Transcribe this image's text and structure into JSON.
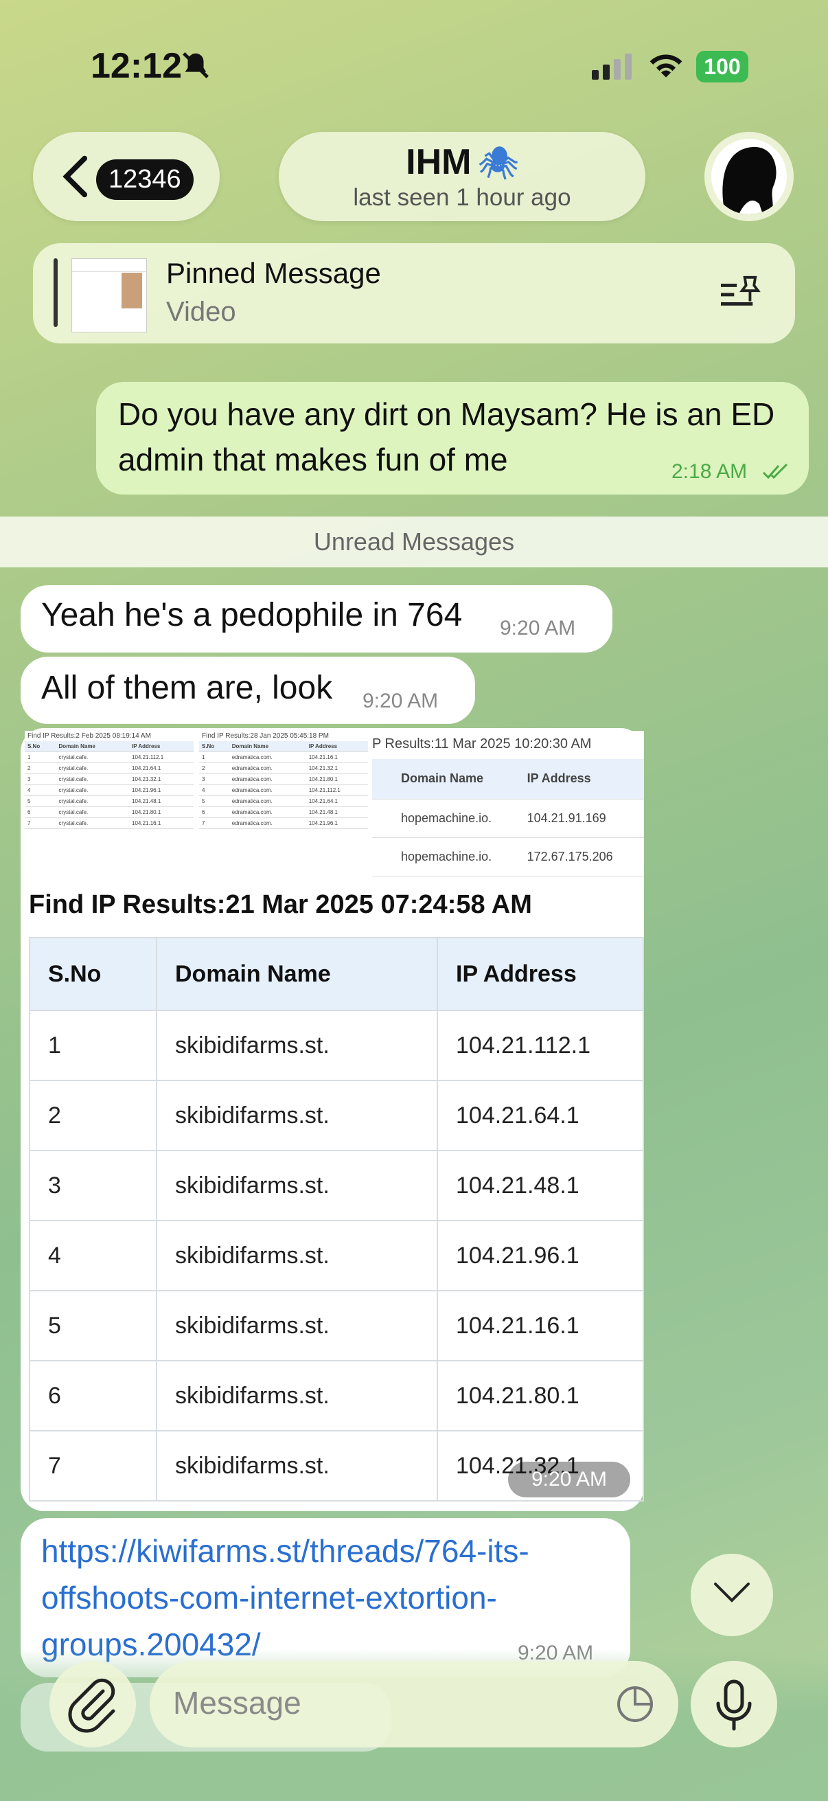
{
  "status_bar": {
    "time": "12:12",
    "battery": "100"
  },
  "header": {
    "back_count": "12346",
    "title": "IHM",
    "title_emoji": "🕷",
    "subtitle": "last seen 1 hour ago"
  },
  "pinned": {
    "title": "Pinned Message",
    "subtitle": "Video"
  },
  "messages": {
    "out_1": {
      "text": "Do you have any dirt on Maysam? He is an ED admin that makes fun of me",
      "time": "2:18 AM"
    },
    "unread_label": "Unread Messages",
    "in_1": {
      "text": "Yeah he's a pedophile in 764",
      "time": "9:20 AM"
    },
    "in_2": {
      "text": "All of them are, look",
      "time": "9:20 AM"
    },
    "album_time": "9:20 AM",
    "link": {
      "text": "https://kiwifarms.st/threads/764-its-offshoots-com-internet-extortion-groups.200432/",
      "time": "9:20 AM"
    }
  },
  "album": {
    "shot_a_title": "Find IP Results:2 Feb 2025 08:19:14 AM",
    "shot_b_title": "Find IP Results:28 Jan 2025 05:45:18 PM",
    "shot_c_title": "P Results:11 Mar 2025 10:20:30 AM",
    "shot_c_rows": [
      {
        "domain": "hopemachine.io.",
        "ip": "104.21.91.169"
      },
      {
        "domain": "hopemachine.io.",
        "ip": "172.67.175.206"
      }
    ],
    "main_title": "Find IP Results:21 Mar 2025 07:24:58 AM",
    "columns": [
      "S.No",
      "Domain Name",
      "IP Address"
    ],
    "rows": [
      [
        "1",
        "skibidifarms.st.",
        "104.21.112.1"
      ],
      [
        "2",
        "skibidifarms.st.",
        "104.21.64.1"
      ],
      [
        "3",
        "skibidifarms.st.",
        "104.21.48.1"
      ],
      [
        "4",
        "skibidifarms.st.",
        "104.21.96.1"
      ],
      [
        "5",
        "skibidifarms.st.",
        "104.21.16.1"
      ],
      [
        "6",
        "skibidifarms.st.",
        "104.21.80.1"
      ],
      [
        "7",
        "skibidifarms.st.",
        "104.21.32.1"
      ]
    ]
  },
  "input": {
    "placeholder": "Message"
  }
}
